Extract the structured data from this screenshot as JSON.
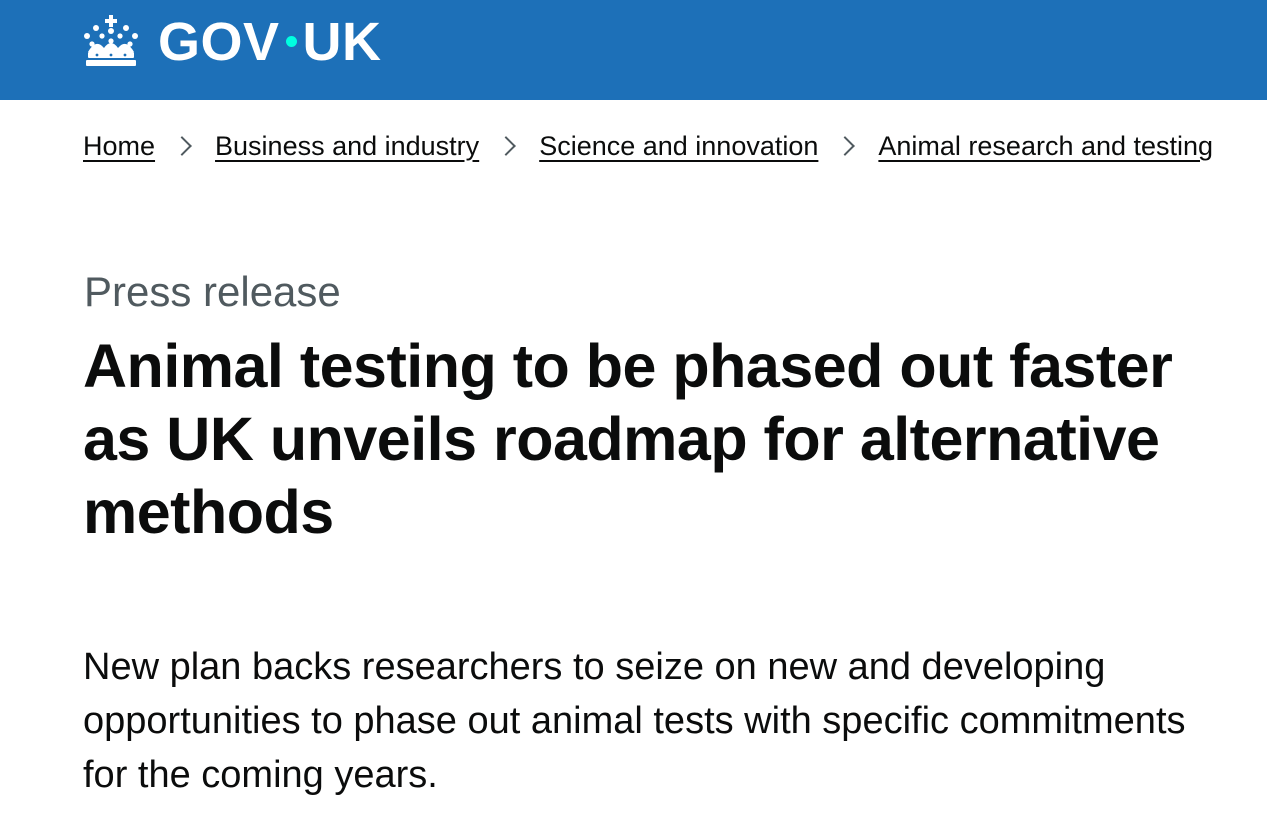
{
  "header": {
    "logo_text_left": "GOV",
    "logo_text_right": "UK",
    "brand_color": "#1d70b8",
    "dot_color": "#00ffe0",
    "crown_icon": "crown-icon"
  },
  "breadcrumbs": {
    "items": [
      {
        "label": "Home"
      },
      {
        "label": "Business and industry"
      },
      {
        "label": "Science and innovation"
      },
      {
        "label": "Animal research and testing"
      }
    ],
    "separator_icon": "chevron-right-icon"
  },
  "article": {
    "caption": "Press release",
    "title": "Animal testing to be phased out faster as UK unveils roadmap for alternative methods",
    "lead": "New plan backs researchers to seize on new and developing opportunities to phase out animal tests with specific commitments for the coming years."
  },
  "colors": {
    "text": "#0b0c0c",
    "secondary_text": "#505a5f"
  }
}
